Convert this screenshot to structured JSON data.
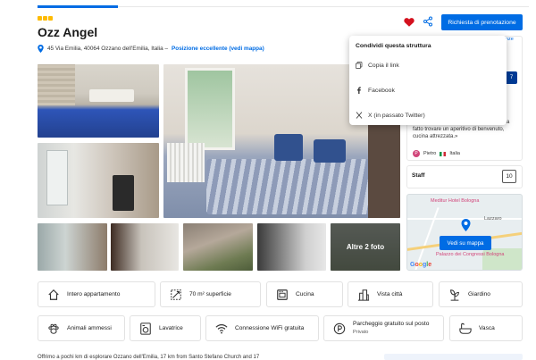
{
  "header": {
    "hotel_name": "Ozz Angel",
    "address": "45 Via Emilia, 40064 Ozzano dell'Emilia, Italia –",
    "location_link": "Posizione eccellente (vedi mappa)",
    "book_button": "Richiesta di prenotazione",
    "star_count": 3,
    "favorite_icon": "heart-icon",
    "share_icon": "share-icon"
  },
  "gallery": {
    "more_photos_label": "Altre 2 foto"
  },
  "share_popup": {
    "title": "Condividi questa struttura",
    "items": [
      {
        "label": "Copia il link",
        "icon": "copy-link-icon"
      },
      {
        "label": "Facebook",
        "icon": "facebook-icon"
      },
      {
        "label": "X (in passato Twitter)",
        "icon": "x-icon"
      }
    ],
    "partial_link": "nze"
  },
  "rating": {
    "score_partial": "7",
    "review_text": "accogliente e ospitale il proprietario ci ha fatto trovare un aperitivo di benvenuto, cucina attrezzata.»",
    "reviewer_initial": "P",
    "reviewer_name": "Pietro",
    "reviewer_country": "Italia"
  },
  "staff": {
    "label": "Staff",
    "score": "10"
  },
  "map": {
    "poi_1": "Meditur Hotel Bologna",
    "poi_2": "Lazzaro",
    "poi_3": "Palazzo dei Congressi Bologna",
    "button": "Vedi su mappa",
    "google_letters": [
      "G",
      "o",
      "o",
      "g",
      "l",
      "e"
    ]
  },
  "facilities": [
    {
      "label": "Intero appartamento",
      "icon": "apartment-icon"
    },
    {
      "label": "70 m² superficie",
      "icon": "area-icon"
    },
    {
      "label": "Cucina",
      "icon": "kitchen-icon"
    },
    {
      "label": "Vista città",
      "icon": "city-view-icon"
    },
    {
      "label": "Giardino",
      "icon": "garden-icon"
    },
    {
      "label": "Animali ammessi",
      "icon": "pets-icon"
    },
    {
      "label": "Lavatrice",
      "icon": "washing-machine-icon"
    },
    {
      "label": "Connessione WiFi gratuita",
      "icon": "wifi-icon"
    },
    {
      "label": "Parcheggio gratuito sul posto",
      "sub": "Privato",
      "icon": "parking-icon"
    },
    {
      "label": "Vasca",
      "icon": "bathtub-icon"
    }
  ],
  "bottom_text": "Offrimo a pochi km di esplorare Ozzano dell'Emilia, 17 km from Santo Stefano Church and 17"
}
